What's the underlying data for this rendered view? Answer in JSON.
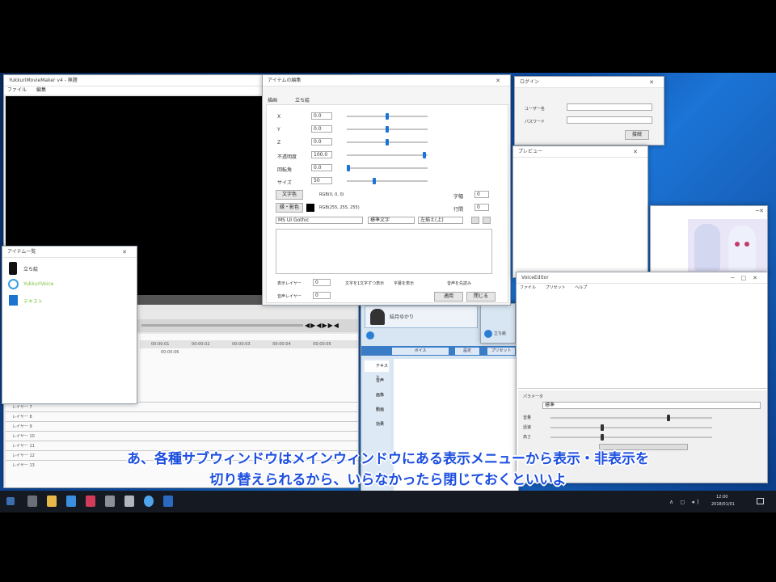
{
  "main_window": {
    "title": "YukkuriMovieMaker v4 - 無題",
    "menu": [
      "ファイル",
      "編集"
    ]
  },
  "timeline_rows": [
    "レイヤー 7",
    "レイヤー 8",
    "レイヤー 9",
    "レイヤー 10",
    "レイヤー 11",
    "レイヤー 12",
    "レイヤー 13"
  ],
  "timeline_times": [
    "00:00:01",
    "00:00:02",
    "00:00:03",
    "00:00:04",
    "00:00:05",
    "00:00:06"
  ],
  "item_window": {
    "title": "アイテム一覧",
    "items": [
      "立ち絵",
      "YukkuriVoice",
      "テキスト"
    ]
  },
  "props_window": {
    "title": "アイテムの編集",
    "tabs": [
      "描画",
      "立ち絵"
    ],
    "rows": [
      {
        "label": "X",
        "value": "0.0"
      },
      {
        "label": "Y",
        "value": "0.0"
      },
      {
        "label": "Z",
        "value": "0.0"
      },
      {
        "label": "不透明度",
        "value": "100.0"
      },
      {
        "label": "回転角",
        "value": "0.0"
      },
      {
        "label": "サイズ",
        "value": "50"
      }
    ],
    "color_btn": "文字色",
    "color_text": "RGB(0, 0, 0)",
    "border_btn": "縁・影色",
    "border_text": "RGB(255, 255, 255)",
    "spin_label_a": "字幅",
    "spin_label_b": "行間",
    "spin_value": "0",
    "font_select": "MS UI Gothic",
    "style_select": "標準文字",
    "align_select": "左揃え(上)",
    "bottom_label_a": "表示レイヤー",
    "bottom_label_b": "音声レイヤー",
    "bottom_value": "0",
    "check_a": "文字を1文字ずつ表示",
    "check_b": "字幕を表示",
    "check_c": "音声を先読み",
    "ok": "適用",
    "cancel": "閉じる"
  },
  "login_window": {
    "title": "ログイン",
    "label_a": "ユーザー名",
    "label_b": "パスワード",
    "button": "接続"
  },
  "blank_window": {
    "title": "プレビュー"
  },
  "voice_panel": {
    "tab_a": "ボイス",
    "tab_b": "設定",
    "tab_c": "プリセット",
    "tabs_right": [
      "立ち絵"
    ],
    "chara_name": "結月ゆかり",
    "items": [
      "テキスト",
      "音声",
      "画像",
      "動画",
      "効果"
    ]
  },
  "voice_editor": {
    "title": "VoiceEditor",
    "menu": [
      "ファイル",
      "プリセット",
      "ヘルプ"
    ],
    "section": "パラメータ",
    "labels": [
      "音量",
      "話速",
      "高さ"
    ],
    "preset": "標準"
  },
  "subtitle": {
    "line1": "あ、各種サブウィンドウはメインウィンドウにある表示メニューから表示・非表示を",
    "line2": "切り替えられるから、いらなかったら閉じておくといいよ"
  },
  "clock": {
    "time": "12:00",
    "date": "2018/01/01"
  }
}
